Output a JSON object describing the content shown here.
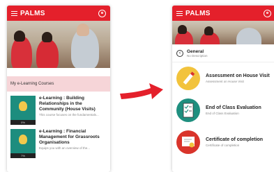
{
  "app": {
    "brand": "PALMS"
  },
  "left_screen": {
    "section_title": "My e-Learning Courses",
    "courses": [
      {
        "title": "e-Learning : Building Relationships in the Community (House Visits)",
        "desc": "This course focuses on the fundamentals...",
        "badge": "0%"
      },
      {
        "title": "e-Learning : Financial Management for Grassroots Organisations",
        "desc": "Equips you with an overview of the...",
        "badge": "7%"
      }
    ]
  },
  "right_screen": {
    "general": {
      "title": "General",
      "subtitle": "No Description"
    },
    "items": [
      {
        "title": "Assessment on House Visit",
        "desc": "Assessment on House Visit",
        "icon": "pencil-icon",
        "color": "#f2c33c"
      },
      {
        "title": "End of Class Evaluation",
        "desc": "End of Class Evaluation",
        "icon": "checklist-icon",
        "color": "#1f8f7f"
      },
      {
        "title": "Certificate of completion",
        "desc": "Certificate of completion",
        "icon": "certificate-icon",
        "color": "#d9342b"
      }
    ]
  },
  "colors": {
    "brand": "#e4202b",
    "section_bg": "#f6d5d8"
  }
}
